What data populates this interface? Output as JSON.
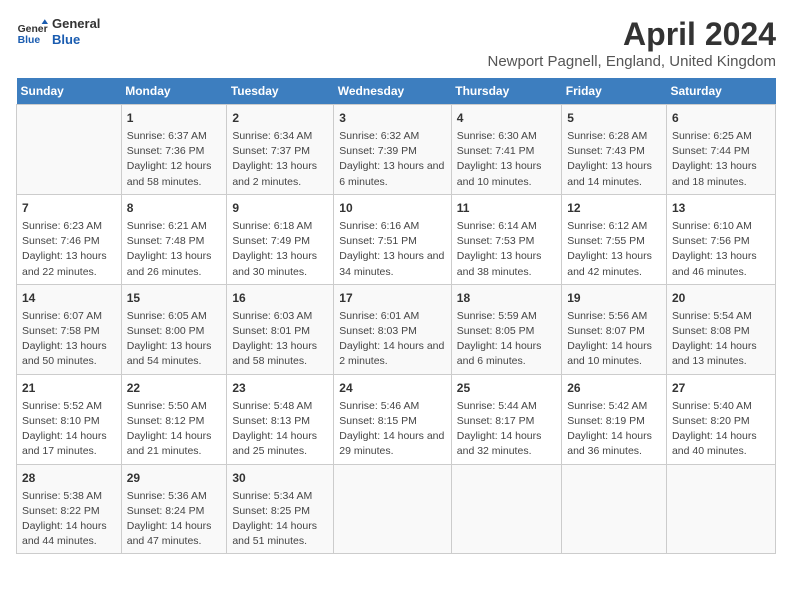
{
  "logo": {
    "general": "General",
    "blue": "Blue"
  },
  "header": {
    "title": "April 2024",
    "subtitle": "Newport Pagnell, England, United Kingdom"
  },
  "days_of_week": [
    "Sunday",
    "Monday",
    "Tuesday",
    "Wednesday",
    "Thursday",
    "Friday",
    "Saturday"
  ],
  "weeks": [
    [
      {
        "day": "",
        "info": ""
      },
      {
        "day": "1",
        "info": "Sunrise: 6:37 AM\nSunset: 7:36 PM\nDaylight: 12 hours and 58 minutes."
      },
      {
        "day": "2",
        "info": "Sunrise: 6:34 AM\nSunset: 7:37 PM\nDaylight: 13 hours and 2 minutes."
      },
      {
        "day": "3",
        "info": "Sunrise: 6:32 AM\nSunset: 7:39 PM\nDaylight: 13 hours and 6 minutes."
      },
      {
        "day": "4",
        "info": "Sunrise: 6:30 AM\nSunset: 7:41 PM\nDaylight: 13 hours and 10 minutes."
      },
      {
        "day": "5",
        "info": "Sunrise: 6:28 AM\nSunset: 7:43 PM\nDaylight: 13 hours and 14 minutes."
      },
      {
        "day": "6",
        "info": "Sunrise: 6:25 AM\nSunset: 7:44 PM\nDaylight: 13 hours and 18 minutes."
      }
    ],
    [
      {
        "day": "7",
        "info": "Sunrise: 6:23 AM\nSunset: 7:46 PM\nDaylight: 13 hours and 22 minutes."
      },
      {
        "day": "8",
        "info": "Sunrise: 6:21 AM\nSunset: 7:48 PM\nDaylight: 13 hours and 26 minutes."
      },
      {
        "day": "9",
        "info": "Sunrise: 6:18 AM\nSunset: 7:49 PM\nDaylight: 13 hours and 30 minutes."
      },
      {
        "day": "10",
        "info": "Sunrise: 6:16 AM\nSunset: 7:51 PM\nDaylight: 13 hours and 34 minutes."
      },
      {
        "day": "11",
        "info": "Sunrise: 6:14 AM\nSunset: 7:53 PM\nDaylight: 13 hours and 38 minutes."
      },
      {
        "day": "12",
        "info": "Sunrise: 6:12 AM\nSunset: 7:55 PM\nDaylight: 13 hours and 42 minutes."
      },
      {
        "day": "13",
        "info": "Sunrise: 6:10 AM\nSunset: 7:56 PM\nDaylight: 13 hours and 46 minutes."
      }
    ],
    [
      {
        "day": "14",
        "info": "Sunrise: 6:07 AM\nSunset: 7:58 PM\nDaylight: 13 hours and 50 minutes."
      },
      {
        "day": "15",
        "info": "Sunrise: 6:05 AM\nSunset: 8:00 PM\nDaylight: 13 hours and 54 minutes."
      },
      {
        "day": "16",
        "info": "Sunrise: 6:03 AM\nSunset: 8:01 PM\nDaylight: 13 hours and 58 minutes."
      },
      {
        "day": "17",
        "info": "Sunrise: 6:01 AM\nSunset: 8:03 PM\nDaylight: 14 hours and 2 minutes."
      },
      {
        "day": "18",
        "info": "Sunrise: 5:59 AM\nSunset: 8:05 PM\nDaylight: 14 hours and 6 minutes."
      },
      {
        "day": "19",
        "info": "Sunrise: 5:56 AM\nSunset: 8:07 PM\nDaylight: 14 hours and 10 minutes."
      },
      {
        "day": "20",
        "info": "Sunrise: 5:54 AM\nSunset: 8:08 PM\nDaylight: 14 hours and 13 minutes."
      }
    ],
    [
      {
        "day": "21",
        "info": "Sunrise: 5:52 AM\nSunset: 8:10 PM\nDaylight: 14 hours and 17 minutes."
      },
      {
        "day": "22",
        "info": "Sunrise: 5:50 AM\nSunset: 8:12 PM\nDaylight: 14 hours and 21 minutes."
      },
      {
        "day": "23",
        "info": "Sunrise: 5:48 AM\nSunset: 8:13 PM\nDaylight: 14 hours and 25 minutes."
      },
      {
        "day": "24",
        "info": "Sunrise: 5:46 AM\nSunset: 8:15 PM\nDaylight: 14 hours and 29 minutes."
      },
      {
        "day": "25",
        "info": "Sunrise: 5:44 AM\nSunset: 8:17 PM\nDaylight: 14 hours and 32 minutes."
      },
      {
        "day": "26",
        "info": "Sunrise: 5:42 AM\nSunset: 8:19 PM\nDaylight: 14 hours and 36 minutes."
      },
      {
        "day": "27",
        "info": "Sunrise: 5:40 AM\nSunset: 8:20 PM\nDaylight: 14 hours and 40 minutes."
      }
    ],
    [
      {
        "day": "28",
        "info": "Sunrise: 5:38 AM\nSunset: 8:22 PM\nDaylight: 14 hours and 44 minutes."
      },
      {
        "day": "29",
        "info": "Sunrise: 5:36 AM\nSunset: 8:24 PM\nDaylight: 14 hours and 47 minutes."
      },
      {
        "day": "30",
        "info": "Sunrise: 5:34 AM\nSunset: 8:25 PM\nDaylight: 14 hours and 51 minutes."
      },
      {
        "day": "",
        "info": ""
      },
      {
        "day": "",
        "info": ""
      },
      {
        "day": "",
        "info": ""
      },
      {
        "day": "",
        "info": ""
      }
    ]
  ]
}
